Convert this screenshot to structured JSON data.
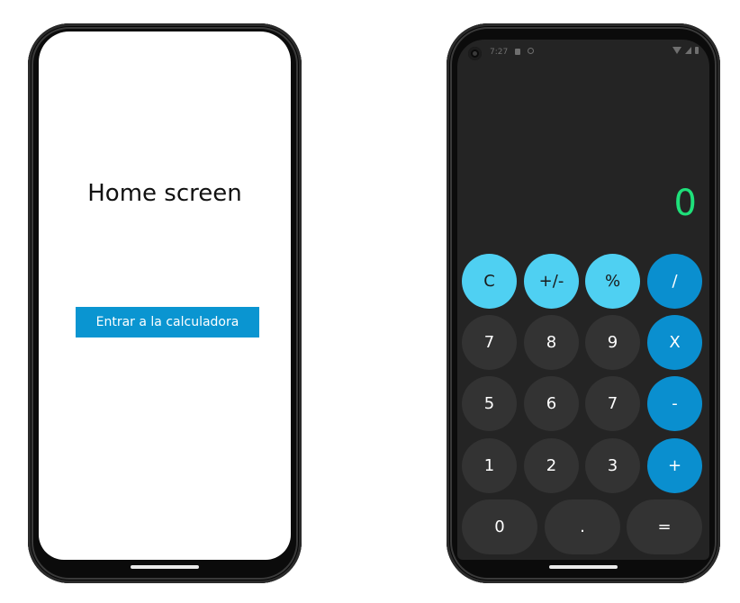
{
  "home": {
    "title": "Home screen",
    "enter_button": "Entrar a la calculadora"
  },
  "calculator": {
    "status": {
      "time": "7:27"
    },
    "display_value": "0",
    "keys": {
      "clear": "C",
      "sign": "+/-",
      "percent": "%",
      "divide": "/",
      "seven": "7",
      "eight": "8",
      "nine": "9",
      "multiply": "X",
      "five": "5",
      "six": "6",
      "seven_b": "7",
      "minus": "-",
      "one": "1",
      "two": "2",
      "three": "3",
      "plus": "+",
      "zero": "0",
      "dot": ".",
      "equals": "="
    },
    "colors": {
      "background": "#242424",
      "display": "#1ee07a",
      "function_key": "#4fd0f2",
      "operator_key": "#0a8fcf",
      "number_key": "#333333"
    }
  },
  "colors": {
    "enter_button": "#0a95d1"
  }
}
